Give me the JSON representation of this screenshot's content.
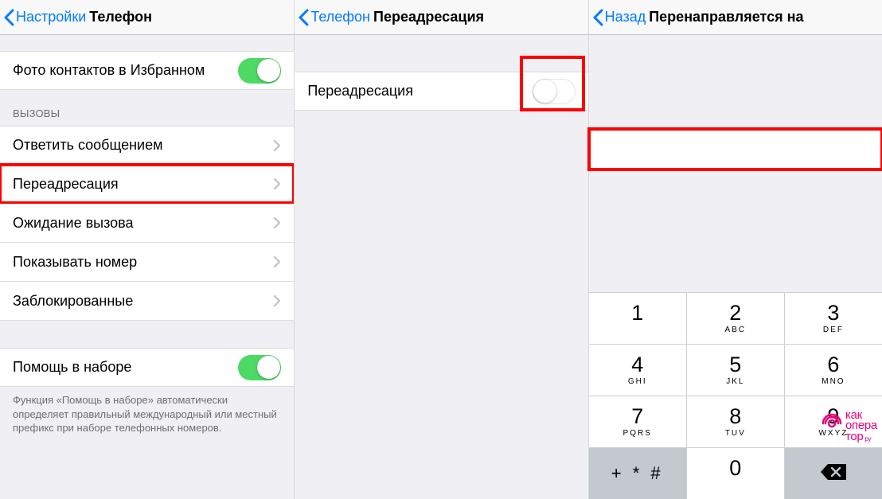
{
  "screen1": {
    "back_label": "Настройки",
    "title": "Телефон",
    "photo_contacts": {
      "label": "Фото контактов в Избранном",
      "on": true
    },
    "calls_header": "ВЫЗОВЫ",
    "rows": [
      {
        "label": "Ответить сообщением"
      },
      {
        "label": "Переадресация"
      },
      {
        "label": "Ожидание вызова"
      },
      {
        "label": "Показывать номер"
      },
      {
        "label": "Заблокированные"
      }
    ],
    "dial_assist": {
      "label": "Помощь в наборе",
      "on": true
    },
    "dial_assist_footer": "Функция «Помощь в наборе» автоматически определяет правильный международный или местный префикс при наборе телефонных номеров."
  },
  "screen2": {
    "back_label": "Телефон",
    "title": "Переадресация",
    "forwarding": {
      "label": "Переадресация",
      "on": false
    }
  },
  "screen3": {
    "back_label": "Назад",
    "title": "Перенаправляется на",
    "input_value": "",
    "keypad": {
      "row1": [
        {
          "digit": "1",
          "letters": ""
        },
        {
          "digit": "2",
          "letters": "ABC"
        },
        {
          "digit": "3",
          "letters": "DEF"
        }
      ],
      "row2": [
        {
          "digit": "4",
          "letters": "GHI"
        },
        {
          "digit": "5",
          "letters": "JKL"
        },
        {
          "digit": "6",
          "letters": "MNO"
        }
      ],
      "row3": [
        {
          "digit": "7",
          "letters": "PQRS"
        },
        {
          "digit": "8",
          "letters": "TUV"
        },
        {
          "digit": "9",
          "letters": "WXYZ"
        }
      ],
      "row4_symbols": "+ * #",
      "row4_zero": "0"
    }
  },
  "watermark": {
    "line1": "как",
    "line2": "опера",
    "line3": "тор",
    "sub": "ру"
  }
}
